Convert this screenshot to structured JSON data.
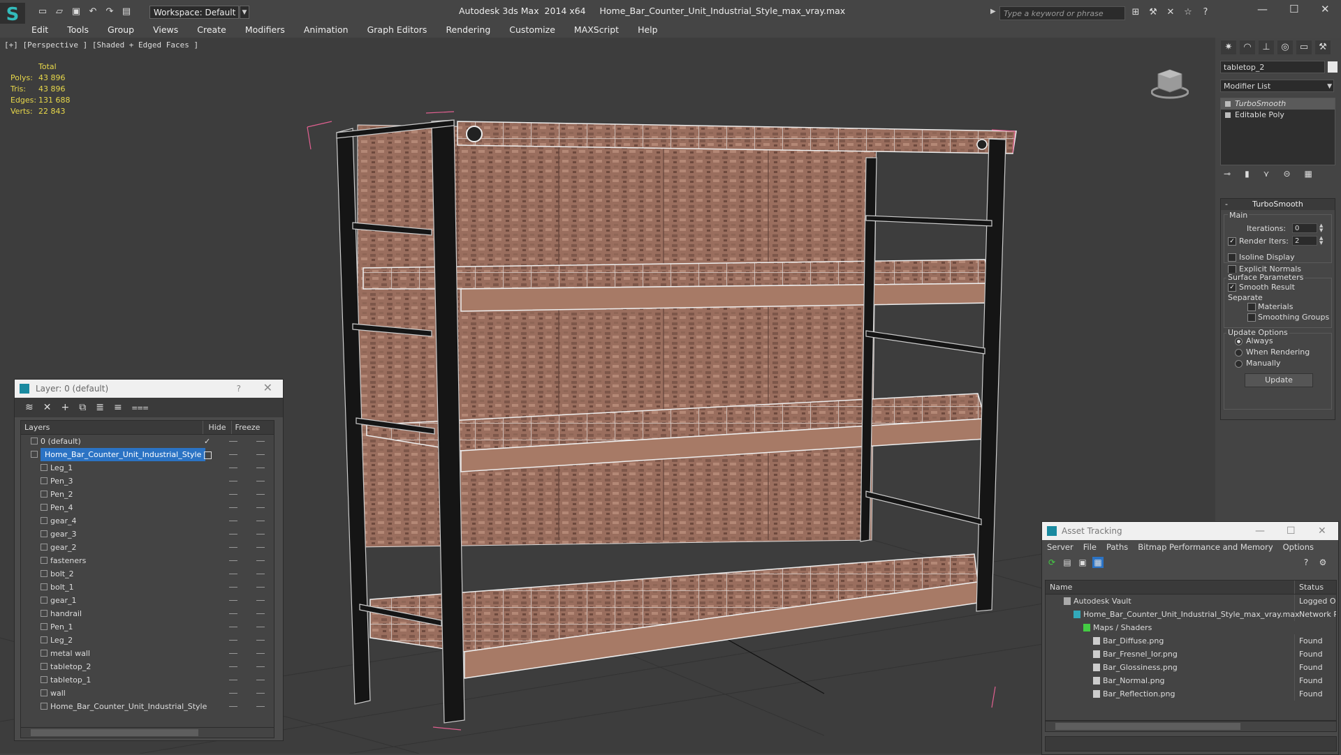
{
  "titlebar": {
    "workspace": "Workspace: Default",
    "app_name": "Autodesk 3ds Max  2014 x64",
    "file_name": "Home_Bar_Counter_Unit_Industrial_Style_max_vray.max",
    "search_placeholder": "Type a keyword or phrase"
  },
  "menu": [
    "Edit",
    "Tools",
    "Group",
    "Views",
    "Create",
    "Modifiers",
    "Animation",
    "Graph Editors",
    "Rendering",
    "Customize",
    "MAXScript",
    "Help"
  ],
  "viewport": {
    "label": "[+] [Perspective ] [Shaded + Edged Faces ]",
    "stats": {
      "header": "Total",
      "rows": [
        {
          "k": "Polys:",
          "v": "43 896"
        },
        {
          "k": "Tris:",
          "v": "43 896"
        },
        {
          "k": "Edges:",
          "v": "131 688"
        },
        {
          "k": "Verts:",
          "v": "22 843"
        }
      ]
    }
  },
  "layer_window": {
    "title": "Layer: 0 (default)",
    "col_layers": "Layers",
    "col_hide": "Hide",
    "col_freeze": "Freeze",
    "rows": [
      {
        "name": "0 (default)",
        "level": 0
      },
      {
        "name": "Home_Bar_Counter_Unit_Industrial_Style",
        "level": 0,
        "selected": true
      },
      {
        "name": "Leg_1",
        "level": 1
      },
      {
        "name": "Pen_3",
        "level": 1
      },
      {
        "name": "Pen_2",
        "level": 1
      },
      {
        "name": "Pen_4",
        "level": 1
      },
      {
        "name": "gear_4",
        "level": 1
      },
      {
        "name": "gear_3",
        "level": 1
      },
      {
        "name": "gear_2",
        "level": 1
      },
      {
        "name": "fasteners",
        "level": 1
      },
      {
        "name": "bolt_2",
        "level": 1
      },
      {
        "name": "bolt_1",
        "level": 1
      },
      {
        "name": "gear_1",
        "level": 1
      },
      {
        "name": "handrail",
        "level": 1
      },
      {
        "name": "Pen_1",
        "level": 1
      },
      {
        "name": "Leg_2",
        "level": 1
      },
      {
        "name": "metal wall",
        "level": 1
      },
      {
        "name": "tabletop_2",
        "level": 1
      },
      {
        "name": "tabletop_1",
        "level": 1
      },
      {
        "name": "wall",
        "level": 1
      },
      {
        "name": "Home_Bar_Counter_Unit_Industrial_Style",
        "level": 1
      }
    ]
  },
  "command_panel": {
    "object_name": "tabletop_2",
    "modifier_list": "Modifier List",
    "stack": [
      "TurboSmooth",
      "Editable Poly"
    ],
    "rollout_title": "TurboSmooth",
    "main_label": "Main",
    "iterations_label": "Iterations:",
    "iterations_value": "0",
    "render_iters_label": "Render Iters:",
    "render_iters_value": "2",
    "isoline": "Isoline Display",
    "explicit_normals": "Explicit Normals",
    "surface_params": "Surface Parameters",
    "smooth_result": "Smooth Result",
    "separate": "Separate",
    "materials": "Materials",
    "smoothing_groups": "Smoothing Groups",
    "update_options": "Update Options",
    "always": "Always",
    "when_rendering": "When Rendering",
    "manually": "Manually",
    "update_button": "Update"
  },
  "asset_tracking": {
    "title": "Asset Tracking",
    "menu": [
      "Server",
      "File",
      "Paths",
      "Bitmap Performance and Memory",
      "Options"
    ],
    "col_name": "Name",
    "col_status": "Status",
    "rows": [
      {
        "name": "Autodesk Vault",
        "status": "Logged Ou",
        "indent": 1
      },
      {
        "name": "Home_Bar_Counter_Unit_Industrial_Style_max_vray.max",
        "status": "Network Pa",
        "indent": 2
      },
      {
        "name": "Maps / Shaders",
        "status": "",
        "indent": 3
      },
      {
        "name": "Bar_Diffuse.png",
        "status": "Found",
        "indent": 4
      },
      {
        "name": "Bar_Fresnel_Ior.png",
        "status": "Found",
        "indent": 4
      },
      {
        "name": "Bar_Glossiness.png",
        "status": "Found",
        "indent": 4
      },
      {
        "name": "Bar_Normal.png",
        "status": "Found",
        "indent": 4
      },
      {
        "name": "Bar_Reflection.png",
        "status": "Found",
        "indent": 4
      }
    ]
  }
}
